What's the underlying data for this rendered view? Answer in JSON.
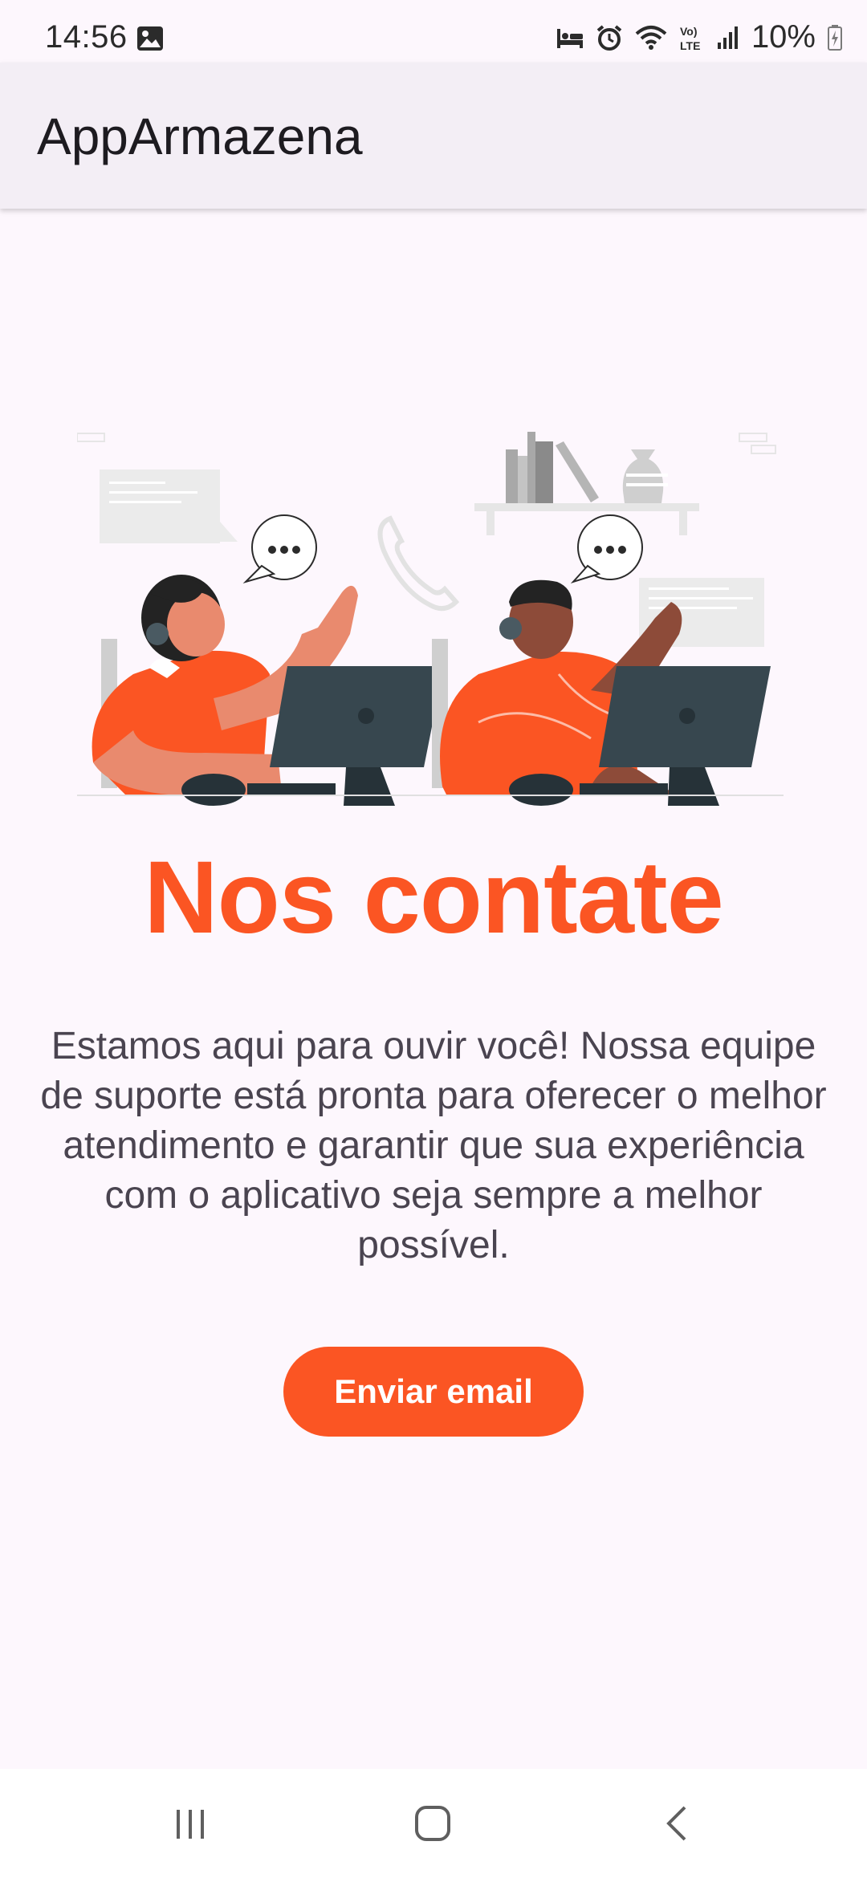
{
  "status_bar": {
    "time": "14:56",
    "battery": "10%",
    "icons": [
      "image-icon",
      "bed-icon",
      "alarm-icon",
      "wifi-icon",
      "volte-icon",
      "signal-icon",
      "battery-icon"
    ]
  },
  "app_bar": {
    "title": "AppArmazena"
  },
  "content": {
    "heading": "Nos contate",
    "description": "Estamos aqui para ouvir você! Nossa equipe de suporte está pronta para oferecer o melhor atendimento e garantir que sua experiência com o aplicativo seja sempre a melhor possível.",
    "button_label": "Enviar email"
  },
  "nav_bar": {
    "icons": [
      "recent-apps-icon",
      "home-icon",
      "back-icon"
    ]
  },
  "colors": {
    "accent": "#fb5523",
    "background": "#fdf7fd",
    "app_bar": "#f3eef5",
    "text": "#4a4450"
  }
}
